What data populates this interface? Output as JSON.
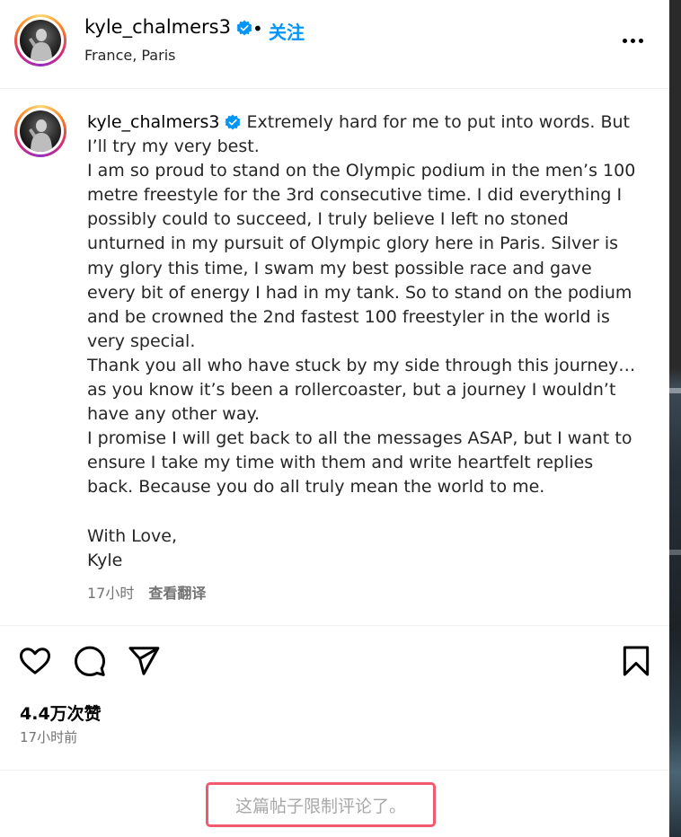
{
  "header": {
    "username": "kyle_chalmers3",
    "separator": "•",
    "follow_label": "关注",
    "location": "France, Paris"
  },
  "post": {
    "username": "kyle_chalmers3",
    "caption_first": "Extremely hard for me to put into words. But I’ll try my very best.",
    "caption_paragraphs": [
      "I am so proud to stand on the Olympic podium in the men’s 100 metre freestyle for the 3rd consecutive time. I did everything I possibly could to succeed, I truly believe I left no stoned unturned in my pursuit of Olympic glory here in Paris. Silver is my glory this time, I swam my best possible race and gave every bit of energy I had in my tank. So to stand on the podium and be crowned the 2nd fastest 100 freestyler in the world is very special.",
      "Thank you all who have stuck by my side through this journey… as you know it’s been a rollercoaster, but a journey I wouldn’t have any other way.",
      "I promise I will get back to all the messages ASAP, but I want to ensure I take my time with them and write heartfelt replies back. Because you do all truly mean the world to me."
    ],
    "signoff_1": "With Love,",
    "signoff_2": "Kyle",
    "caption_time": "17小时",
    "translate_label": "查看翻译"
  },
  "actions": {
    "like_icon": "heart-icon",
    "comment_icon": "comment-icon",
    "share_icon": "send-icon",
    "save_icon": "bookmark-icon"
  },
  "stats": {
    "likes": "4.4万次赞",
    "posted": "17小时前"
  },
  "comments": {
    "restricted_text": "这篇帖子限制评论了。"
  },
  "colors": {
    "accent": "#0095f6",
    "verified": "#0095f6",
    "highlight_border": "#f05a6e",
    "muted_text": "#737373"
  }
}
